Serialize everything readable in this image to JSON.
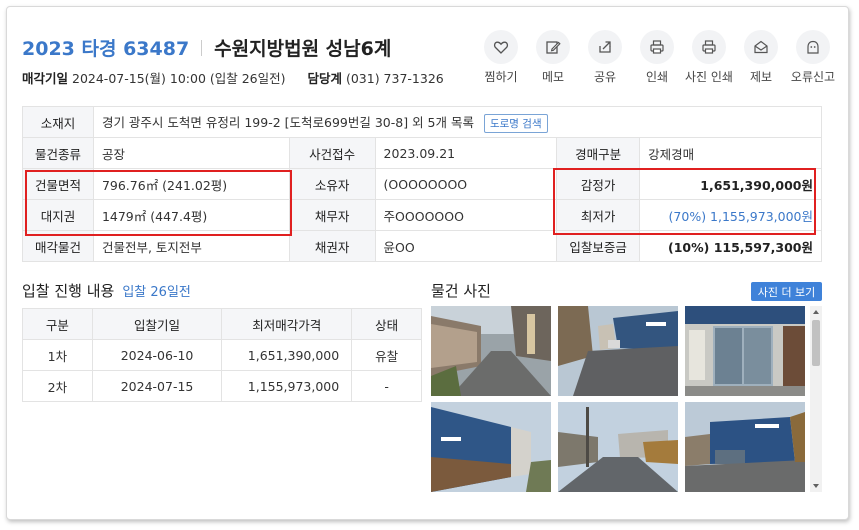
{
  "header": {
    "case_number": "2023 타경 63487",
    "court": "수원지방법원 성남6계",
    "sale_date_label": "매각기일",
    "sale_date_value": "2024-07-15(월) 10:00 (입찰 26일전)",
    "manager_label": "담당계",
    "manager_phone": "(031) 737-1326"
  },
  "actions": [
    {
      "label": "찜하기",
      "icon": "heart-icon"
    },
    {
      "label": "메모",
      "icon": "edit-icon"
    },
    {
      "label": "공유",
      "icon": "share-icon"
    },
    {
      "label": "인쇄",
      "icon": "print-icon"
    },
    {
      "label": "사진 인쇄",
      "icon": "photo-print-icon"
    },
    {
      "label": "제보",
      "icon": "report-icon"
    },
    {
      "label": "오류신고",
      "icon": "error-report-icon"
    }
  ],
  "info": {
    "location_label": "소재지",
    "location_value": "경기 광주시 도척면 유정리 199-2 [도척로699번길 30-8] 외 5개 목록",
    "road_search": "도로명 검색",
    "type_label": "물건종류",
    "type_value": "공장",
    "received_label": "사건접수",
    "received_value": "2023.09.21",
    "auction_type_label": "경매구분",
    "auction_type_value": "강제경매",
    "building_area_label": "건물면적",
    "building_area_value": "796.76㎡ (241.02평)",
    "owner_label": "소유자",
    "owner_value": "(OOOOOOOO",
    "appraisal_label": "감정가",
    "appraisal_value": "1,651,390,000원",
    "land_right_label": "대지권",
    "land_right_value": "1479㎡ (447.4평)",
    "debtor_label": "채무자",
    "debtor_value": "주OOOOOOO",
    "min_price_label": "최저가",
    "min_price_value": "(70%) 1,155,973,000원",
    "sale_items_label": "매각물건",
    "sale_items_value": "건물전부, 토지전부",
    "creditor_label": "채권자",
    "creditor_value": "윤OO",
    "deposit_label": "입찰보증금",
    "deposit_value": "(10%) 115,597,300원"
  },
  "bid_section": {
    "title": "입찰 진행 내용",
    "subtitle": "입찰 26일전",
    "columns": [
      "구분",
      "입찰기일",
      "최저매각가격",
      "상태"
    ],
    "rows": [
      [
        "1차",
        "2024-06-10",
        "1,651,390,000",
        "유찰"
      ],
      [
        "2차",
        "2024-07-15",
        "1,155,973,000",
        "-"
      ]
    ]
  },
  "photo_section": {
    "title": "물건 사진",
    "more_button": "사진 더 보기"
  }
}
